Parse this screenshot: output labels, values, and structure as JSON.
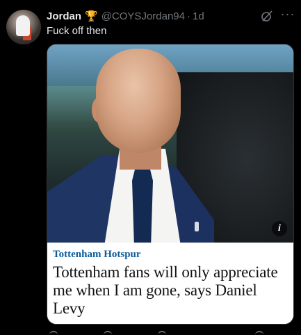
{
  "tweet": {
    "author_name": "Jordan",
    "author_badge_icon": "trophy-icon",
    "handle": "@COYSJordan94",
    "separator": "·",
    "time": "1d",
    "text": "Fuck off then"
  },
  "card": {
    "kicker": "Tottenham Hotspur",
    "headline": "Tottenham fans will only appreciate me when I am gone, says Daniel Levy",
    "info_label": "i",
    "kicker_color": "#0a5b9c"
  },
  "icons": {
    "grok": "grok-icon",
    "more": "more-icon",
    "more_glyph": "···"
  }
}
